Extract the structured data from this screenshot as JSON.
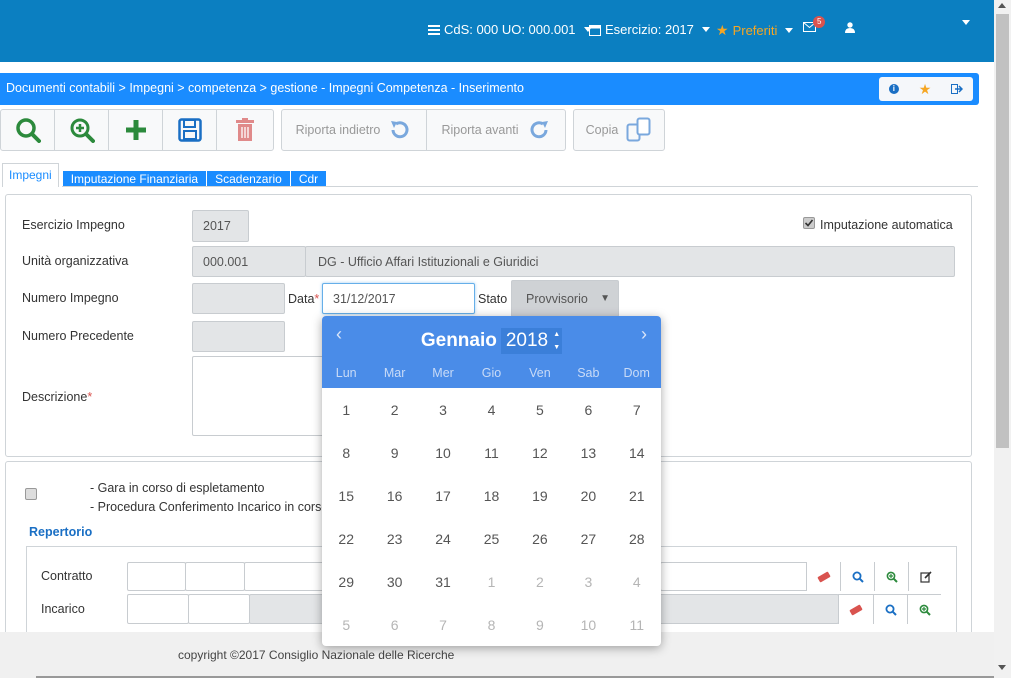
{
  "topbar": {
    "cds_uo": "CdS: 000 UO: 000.001",
    "esercizio": "Esercizio: 2017",
    "preferiti": "Preferiti",
    "messages_count": "5"
  },
  "breadcrumb": "Documenti contabili > Impegni > competenza > gestione - Impegni Competenza - Inserimento",
  "toolbar": {
    "riporta_indietro": "Riporta indietro",
    "riporta_avanti": "Riporta avanti",
    "copia": "Copia"
  },
  "tabs": [
    "Impegni",
    "Imputazione Finanziaria",
    "Scadenzario",
    "Cdr"
  ],
  "form": {
    "esercizio_label": "Esercizio Impegno",
    "esercizio_value": "2017",
    "imputazione_label": "Imputazione automatica",
    "unita_label": "Unità organizzativa",
    "unita_code": "000.001",
    "unita_desc": "DG - Ufficio Affari Istituzionali e Giuridici",
    "numero_label": "Numero Impegno",
    "data_label": "Data",
    "data_value": "31/12/2017",
    "stato_label": "Stato",
    "stato_value": "Provvisorio",
    "precedente_label": "Numero Precedente",
    "descrizione_label": "Descrizione"
  },
  "section2": {
    "gara_label": "- Gara in corso di espletamento",
    "procedura_label": "- Procedura Conferimento Incarico in corso",
    "repertorio_title": "Repertorio",
    "contratto_label": "Contratto",
    "incarico_label": "Incarico"
  },
  "datepicker": {
    "month": "Gennaio",
    "year": "2018",
    "weekdays": [
      "Lun",
      "Mar",
      "Mer",
      "Gio",
      "Ven",
      "Sab",
      "Dom"
    ],
    "days": [
      "1",
      "2",
      "3",
      "4",
      "5",
      "6",
      "7",
      "8",
      "9",
      "10",
      "11",
      "12",
      "13",
      "14",
      "15",
      "16",
      "17",
      "18",
      "19",
      "20",
      "21",
      "22",
      "23",
      "24",
      "25",
      "26",
      "27",
      "28",
      "29",
      "30",
      "31",
      "1",
      "2",
      "3",
      "4",
      "5",
      "6",
      "7",
      "8",
      "9",
      "10",
      "11"
    ],
    "muted_from": 31
  },
  "footer": "copyright ©2017 Consiglio Nazionale delle Ricerche",
  "colors": {
    "topbar": "#0b7fc1",
    "accent": "#1a8cff",
    "datepicker_header": "#4a8ce8",
    "search_icon": "#2c8a3c",
    "add_icon": "#2c8a3c",
    "save_icon": "#1a6fc4",
    "delete_icon": "#e08a8a",
    "star": "#f5a623"
  }
}
